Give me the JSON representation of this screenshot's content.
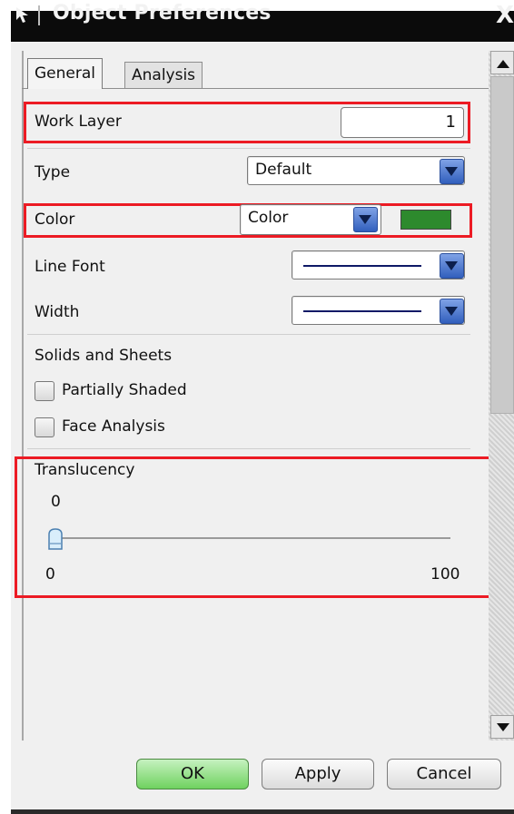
{
  "window": {
    "title": "Object Preferences",
    "close_glyph": "X",
    "title_icon": "select-arrow-icon"
  },
  "tabs": [
    {
      "label": "General",
      "active": true
    },
    {
      "label": "Analysis",
      "active": false
    }
  ],
  "general": {
    "work_layer": {
      "label": "Work Layer",
      "value": "1"
    },
    "type": {
      "label": "Type",
      "selected": "Default"
    },
    "color": {
      "label": "Color",
      "selected": "Color",
      "swatch": "#2d8a2d"
    },
    "line_font": {
      "label": "Line Font",
      "selected": "solid-line"
    },
    "width": {
      "label": "Width",
      "selected": "thin-line"
    },
    "solids_and_sheets": {
      "heading": "Solids and Sheets",
      "partially_shaded": {
        "label": "Partially Shaded",
        "checked": false
      },
      "face_analysis": {
        "label": "Face Analysis",
        "checked": false
      }
    },
    "translucency": {
      "label": "Translucency",
      "current": "0",
      "min": "0",
      "max": "100",
      "value_fraction": 0
    }
  },
  "buttons": {
    "ok": "OK",
    "apply": "Apply",
    "cancel": "Cancel"
  },
  "colors": {
    "highlight_box": "#ec1b24",
    "ok_button": "#6fd25f",
    "dropdown_button": "#315fbd"
  }
}
